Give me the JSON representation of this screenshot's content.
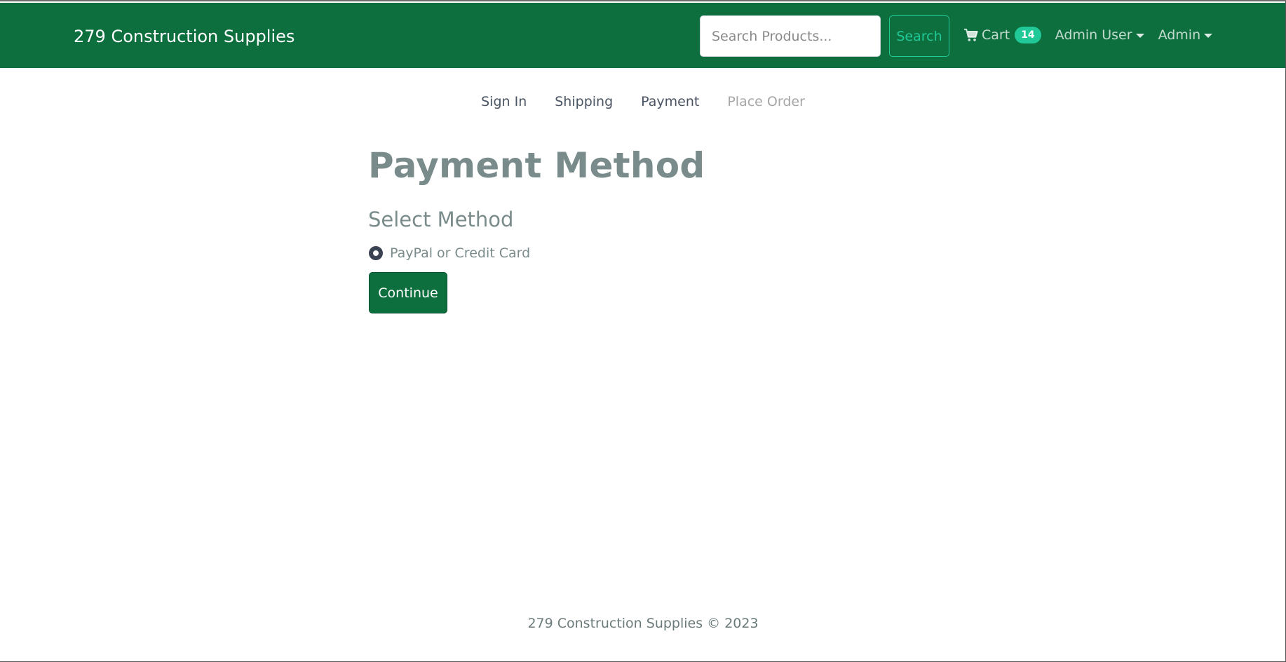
{
  "navbar": {
    "brand": "279 Construction Supplies",
    "search_placeholder": "Search Products...",
    "search_button": "Search",
    "cart_label": "Cart",
    "cart_count": "14",
    "user_menu": "Admin User",
    "admin_menu": "Admin"
  },
  "steps": [
    {
      "label": "Sign In",
      "state": "active"
    },
    {
      "label": "Shipping",
      "state": "active"
    },
    {
      "label": "Payment",
      "state": "active"
    },
    {
      "label": "Place Order",
      "state": "disabled"
    }
  ],
  "main": {
    "title": "Payment Method",
    "subtitle": "Select Method",
    "payment_option": "PayPal or Credit Card",
    "payment_option_checked": true,
    "continue_button": "Continue"
  },
  "footer": {
    "text": "279 Construction Supplies © 2023"
  },
  "colors": {
    "navbar_bg": "#0d6e3e",
    "accent_teal": "#20c997",
    "heading": "#7a8b8b"
  },
  "icons": {
    "cart": "shopping-cart-icon"
  }
}
